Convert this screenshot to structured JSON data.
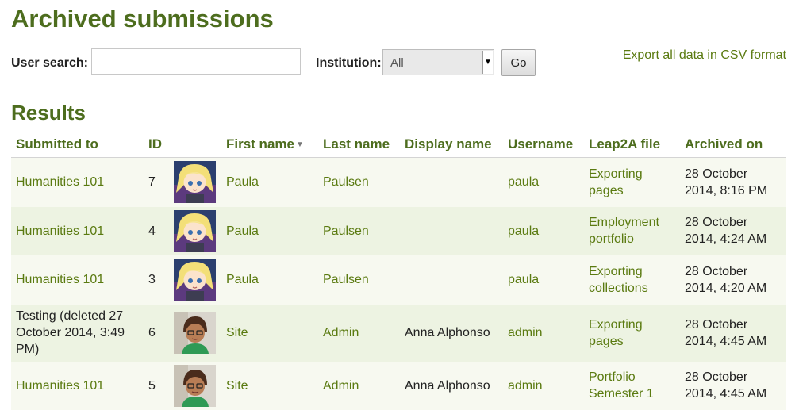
{
  "page_title": "Archived submissions",
  "search": {
    "user_label": "User search:",
    "user_value": "",
    "institution_label": "Institution:",
    "institution_selected": "All",
    "go_label": "Go"
  },
  "export_link": "Export all data in CSV format",
  "results_title": "Results",
  "columns": [
    "Submitted to",
    "ID",
    "",
    "First name",
    "Last name",
    "Display name",
    "Username",
    "Leap2A file",
    "Archived on"
  ],
  "rows": [
    {
      "submitted_to": "Humanities 101",
      "id": "7",
      "avatar": "paula",
      "first": "Paula",
      "last": "Paulsen",
      "display": "",
      "username": "paula",
      "file": "Exporting pages",
      "archived": "28 October 2014, 8:16 PM",
      "submitted_link": true
    },
    {
      "submitted_to": "Humanities 101",
      "id": "4",
      "avatar": "paula",
      "first": "Paula",
      "last": "Paulsen",
      "display": "",
      "username": "paula",
      "file": "Employment portfolio",
      "archived": "28 October 2014, 4:24 AM",
      "submitted_link": true
    },
    {
      "submitted_to": "Humanities 101",
      "id": "3",
      "avatar": "paula",
      "first": "Paula",
      "last": "Paulsen",
      "display": "",
      "username": "paula",
      "file": "Exporting collections",
      "archived": "28 October 2014, 4:20 AM",
      "submitted_link": true
    },
    {
      "submitted_to": "Testing (deleted 27 October 2014, 3:49 PM)",
      "id": "6",
      "avatar": "admin",
      "first": "Site",
      "last": "Admin",
      "display": "Anna Alphonso",
      "username": "admin",
      "file": "Exporting pages",
      "archived": "28 October 2014, 4:45 AM",
      "submitted_link": false
    },
    {
      "submitted_to": "Humanities 101",
      "id": "5",
      "avatar": "admin",
      "first": "Site",
      "last": "Admin",
      "display": "Anna Alphonso",
      "username": "admin",
      "file": "Portfolio Semester 1",
      "archived": "28 October 2014, 4:45 AM",
      "submitted_link": true
    }
  ]
}
